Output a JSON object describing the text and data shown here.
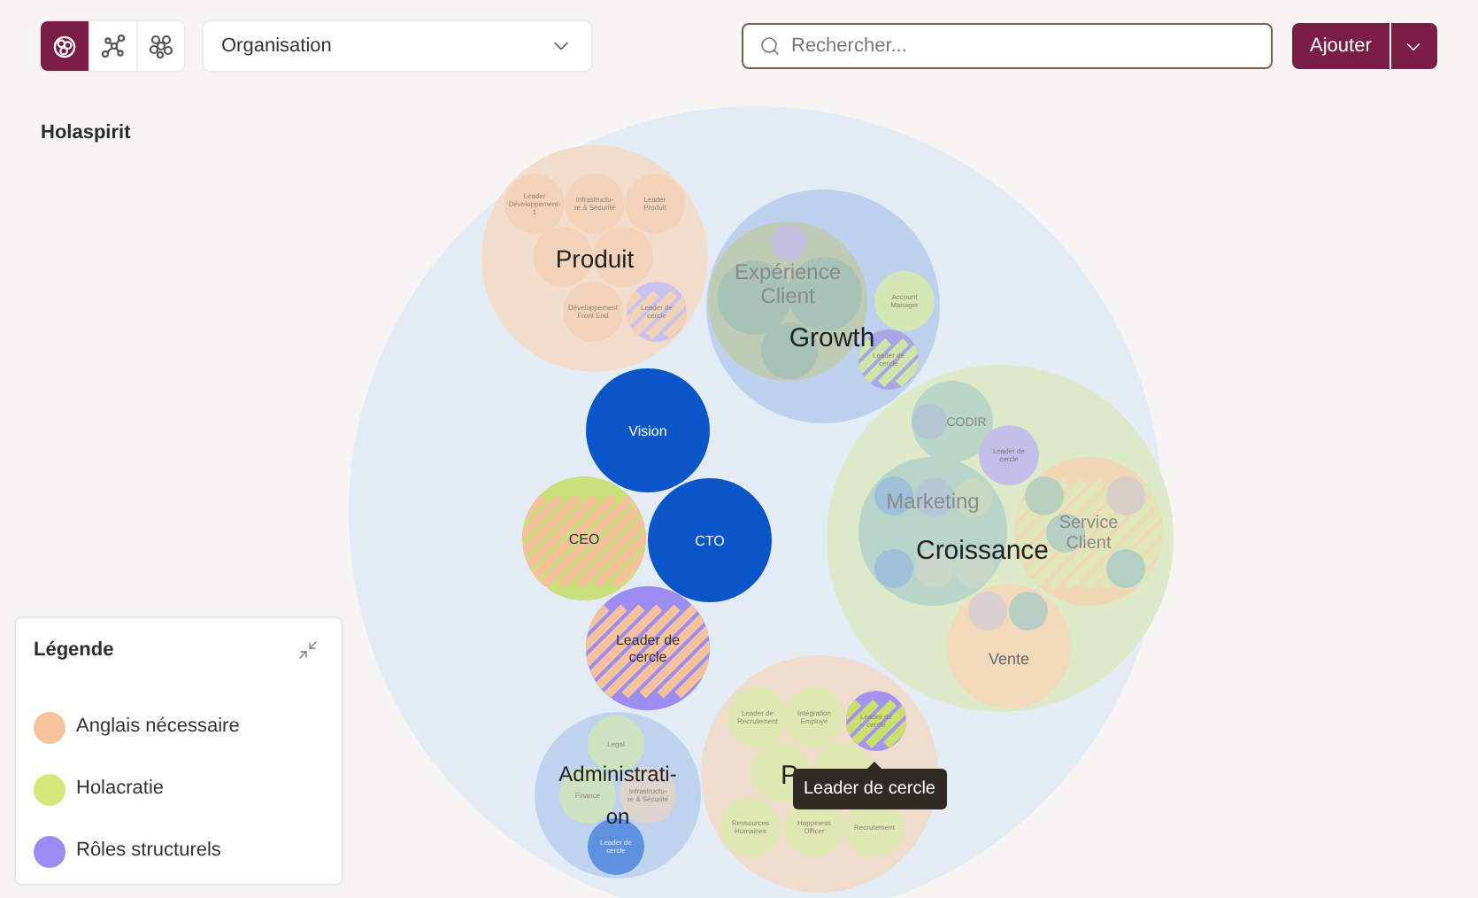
{
  "toolbar": {
    "views": [
      {
        "selected": true
      },
      {
        "selected": false
      },
      {
        "selected": false
      }
    ],
    "dropdown": {
      "value": "Organisation"
    },
    "search": {
      "placeholder": "Rechercher..."
    },
    "add_button": "Ajouter"
  },
  "organisation_title": "Holaspirit",
  "circles": [
    {
      "color": "#e3ebf5"
    },
    {
      "label": "Produit",
      "color": "#f2ddcc",
      "children": [
        {
          "label": "Leader\nDéveloppement-\n1",
          "color": "#f2d2b8"
        },
        {
          "label": "Infrastructu-\nre & Sécurité",
          "color": "#f2d2b8"
        },
        {
          "label": "Leader\nProduit",
          "color": "#f2d2b8"
        },
        {
          "color": "#f2d2b8"
        },
        {
          "color": "#f2d2b8"
        },
        {
          "label": "Développement\nFront End",
          "color": "#f2d2b8"
        },
        {
          "label": "Leader de\ncercle",
          "color": "#c9c2ef",
          "stripe": {
            "color": "#f2d2b8"
          }
        }
      ]
    },
    {
      "label": "Growth",
      "color": "#bdd1ee",
      "children": [
        {
          "label": "Expérience\nClient",
          "color": "#bfcbb5",
          "children": [
            {
              "color": "#a8c2b8"
            },
            {
              "color": "#a8c2b8"
            },
            {
              "color": "#a8c2b8"
            },
            {
              "color": "#c5bfe0"
            }
          ]
        },
        {
          "label": "Account\nManager",
          "color": "#d4e6b4"
        },
        {
          "label": "Leader de\ncercle",
          "color": "#aaa6e6",
          "stripe": {
            "color": "#d0e3a8"
          }
        }
      ]
    },
    {
      "label": "Croissance",
      "color": "#dde9c8",
      "children": [
        {
          "label": "CODIR",
          "color": "#b9d6c6",
          "children": [
            {
              "color": "#b3c6d2"
            }
          ]
        },
        {
          "label": "Leader de\ncercle",
          "color": "#c4bfe8"
        },
        {
          "label": "Marketing",
          "color": "#b7d5c9",
          "children": [
            {
              "color": "#9fc0d8"
            },
            {
              "color": "#b5c8d8"
            },
            {
              "color": "#c9d8c0"
            },
            {
              "color": "#9fc0d8"
            },
            {
              "color": "#c9d6c8"
            },
            {
              "color": "#c9d6c8"
            }
          ]
        },
        {
          "label": "Service\nClient",
          "color": "#f0d7b6",
          "stripe": {
            "color": "#dfe7b8"
          },
          "children": [
            {
              "color": "#b8cfc0"
            },
            {
              "color": "#d9cfc8"
            },
            {
              "color": "#b8d0c4"
            },
            {
              "color": "#b4cfc4"
            }
          ]
        },
        {
          "label": "Vente",
          "color": "#f1d9ba",
          "children": [
            {
              "color": "#dccfd0"
            },
            {
              "color": "#b8cfc4"
            }
          ]
        }
      ]
    },
    {
      "label": "Vision",
      "color": "#0a56c9"
    },
    {
      "label": "CEO",
      "color": "#c9e07c",
      "stripe": {
        "color": "#f5c29c"
      }
    },
    {
      "label": "CTO",
      "color": "#0a56c9"
    },
    {
      "label": "Leader de\ncercle",
      "color": "#9d8cf2",
      "stripe": {
        "color": "#f5c29c"
      }
    },
    {
      "label": "Administrati-\non",
      "color": "#bfd3ee",
      "children": [
        {
          "label": "Legal",
          "color": "#cfe2bf"
        },
        {
          "label": "Finance",
          "color": "#cfe2bf"
        },
        {
          "label": "Infrastructu-\nre & Sécurité",
          "color": "#dcd4cd"
        },
        {
          "label": "Leader de\ncercle",
          "color": "#5e91e0"
        }
      ]
    },
    {
      "label": "P",
      "color": "#f0dccd",
      "children": [
        {
          "label": "Leader de\nRecrutement",
          "color": "#dde8b2"
        },
        {
          "label": "Intégration\nEmployé",
          "color": "#dde8b2"
        },
        {
          "label": "Leader de\ncercle",
          "color": "#a593f2",
          "stripe": {
            "color": "#c8e06c"
          }
        },
        {
          "color": "#dde8b2"
        },
        {
          "color": "#dde8b2"
        },
        {
          "label": "Ressources\nHumaines",
          "color": "#dde8b2"
        },
        {
          "label": "Happiness\nOfficer",
          "color": "#dde8b2"
        },
        {
          "label": "Recrutement",
          "color": "#dde8b2"
        }
      ]
    }
  ],
  "tooltip": {
    "text": "Leader de cercle"
  },
  "legend": {
    "title": "Légende",
    "items": [
      {
        "label": "Anglais nécessaire",
        "color": "#f5c49c"
      },
      {
        "label": "Holacratie",
        "color": "#d4e87a"
      },
      {
        "label": "Rôles structurels",
        "color": "#9b8cf5"
      }
    ]
  }
}
